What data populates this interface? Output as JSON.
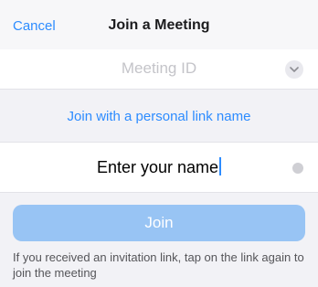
{
  "nav": {
    "cancel_label": "Cancel",
    "title": "Join a Meeting"
  },
  "meeting_id": {
    "placeholder": "Meeting ID",
    "value": ""
  },
  "personal_link": {
    "label": "Join with a personal link name"
  },
  "name_field": {
    "value": "Enter your name"
  },
  "join_button": {
    "label": "Join",
    "enabled": false
  },
  "hint": {
    "text": "If you received an invitation link, tap on the link again to join the meeting"
  },
  "colors": {
    "accent": "#2d8cff",
    "join_disabled": "#98c4f4",
    "background": "#f2f2f6"
  },
  "icons": {
    "meeting_dropdown": "chevron-down-icon",
    "name_clear": "clear-icon"
  }
}
